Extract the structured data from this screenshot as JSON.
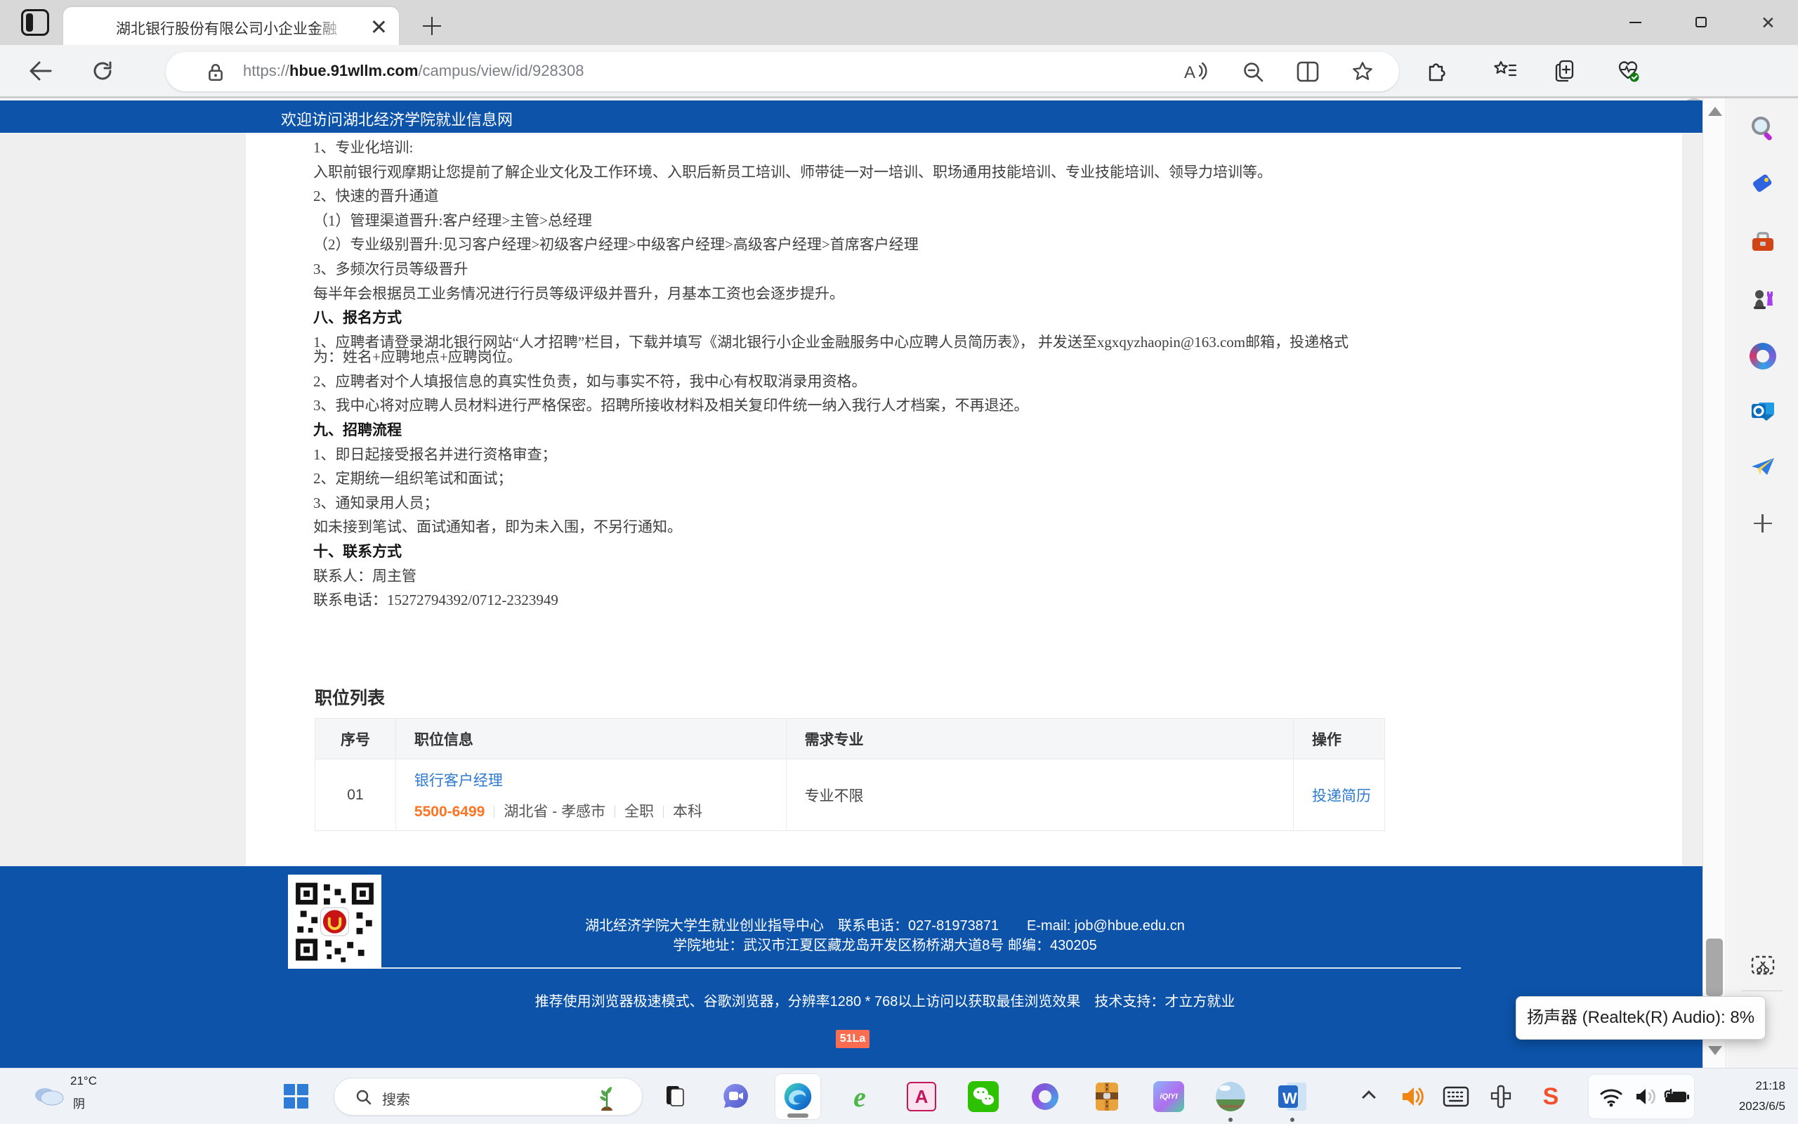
{
  "colors": {
    "accent_blue": "#0c53a9",
    "link_blue": "#2e7ad1",
    "salary_orange": "#ff7422",
    "badge_orange": "#fb6d51"
  },
  "browser": {
    "tab_title": "湖北银行股份有限公司小企业金融",
    "url_scheme": "https://",
    "url_host": "hbue.91wllm.com",
    "url_path": "/campus/view/id/928308"
  },
  "banner": {
    "text": "欢迎访问湖北经济学院就业信息网"
  },
  "article": {
    "paragraphs": [
      {
        "text": "1、专业化培训:"
      },
      {
        "text": "入职前银行观摩期让您提前了解企业文化及工作环境、入职后新员工培训、师带徒一对一培训、职场通用技能培训、专业技能培训、领导力培训等。"
      },
      {
        "text": "2、快速的晋升通道"
      },
      {
        "text": "（1）管理渠道晋升:客户经理>主管>总经理"
      },
      {
        "text": "（2）专业级别晋升:见习客户经理>初级客户经理>中级客户经理>高级客户经理>首席客户经理"
      },
      {
        "text": "3、多频次行员等级晋升"
      },
      {
        "text": "每半年会根据员工业务情况进行行员等级评级并晋升，月基本工资也会逐步提升。"
      },
      {
        "text": "八、报名方式"
      },
      {
        "text": "1、应聘者请登录湖北银行网站“人才招聘”栏目，下载并填写《湖北银行小企业金融服务中心应聘人员简历表》， 并发送至xgxqyzhaopin@163.com邮箱，投递格式为：姓名+应聘地点+应聘岗位。"
      },
      {
        "text": "2、应聘者对个人填报信息的真实性负责，如与事实不符，我中心有权取消录用资格。"
      },
      {
        "text": "3、我中心将对应聘人员材料进行严格保密。招聘所接收材料及相关复印件统一纳入我行人才档案，不再退还。"
      },
      {
        "text": "九、招聘流程"
      },
      {
        "text": "1、即日起接受报名并进行资格审查；"
      },
      {
        "text": "2、定期统一组织笔试和面试；"
      },
      {
        "text": "3、通知录用人员；"
      },
      {
        "text": "如未接到笔试、面试通知者，即为未入围，不另行通知。"
      },
      {
        "text": "十、联系方式"
      },
      {
        "text": "联系人：周主管"
      },
      {
        "text": "联系电话：15272794392/0712-2323949"
      }
    ]
  },
  "job_section": {
    "title": "职位列表",
    "headers": {
      "no": "序号",
      "info": "职位信息",
      "major": "需求专业",
      "action": "操作"
    },
    "row": {
      "no": "01",
      "title": "银行客户经理",
      "salary": "5500-6499",
      "location": "湖北省 - 孝感市",
      "employment": "全职",
      "degree": "本科",
      "major": "专业不限",
      "action": "投递简历"
    }
  },
  "footer": {
    "line1": "湖北经济学院大学生就业创业指导中心　联系电话：027-81973871　　E-mail: job@hbue.edu.cn",
    "line2": "学院地址：武汉市江夏区藏龙岛开发区杨桥湖大道8号 邮编：430205",
    "line3": "推荐使用浏览器极速模式、谷歌浏览器，分辨率1280 * 768以上访问以获取最佳浏览效果　技术支持：才立方就业",
    "badge": "51La"
  },
  "volume_tooltip": {
    "text": "扬声器 (Realtek(R) Audio): 8%"
  },
  "taskbar": {
    "weather": {
      "temp": "21°C",
      "condition": "阴"
    },
    "search_placeholder": "搜索",
    "clock": {
      "time": "21:18",
      "date": "2023/6/5"
    }
  },
  "glyphs": {
    "ie": "e",
    "access": "A",
    "word": "W",
    "sogou": "S",
    "iqiyi": "iQIYI"
  }
}
